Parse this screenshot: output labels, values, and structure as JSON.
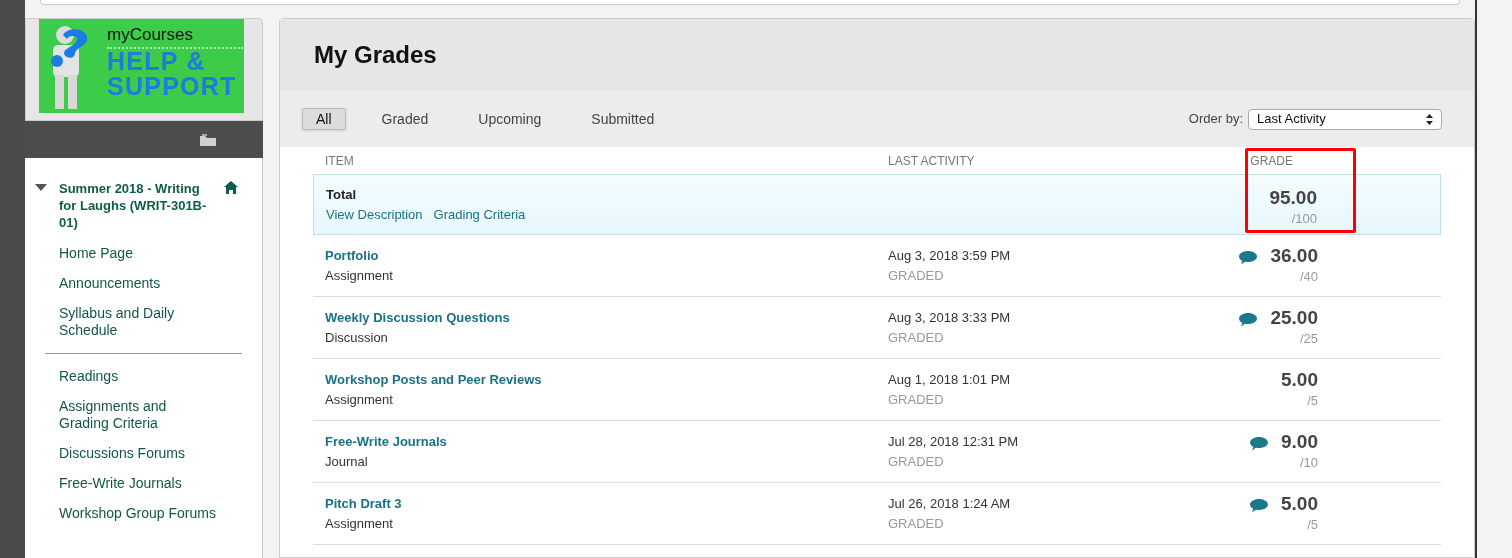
{
  "logo": {
    "title": "myCourses",
    "line_1": "HELP &",
    "line_2": "SUPPORT"
  },
  "course": {
    "title": "Summer 2018 - Writing for Laughs (WRIT-301B-01)",
    "expanded": true
  },
  "menu": {
    "groups": [
      {
        "items": [
          {
            "label": "Home Page"
          },
          {
            "label": "Announcements"
          },
          {
            "label": "Syllabus and Daily Schedule"
          }
        ]
      },
      {
        "items": [
          {
            "label": "Readings"
          },
          {
            "label": "Assignments and Grading Criteria"
          },
          {
            "label": "Discussions Forums"
          },
          {
            "label": "Free-Write Journals"
          },
          {
            "label": "Workshop Group Forums"
          }
        ]
      }
    ]
  },
  "page_title": "My Grades",
  "filters": [
    {
      "label": "All",
      "selected": true
    },
    {
      "label": "Graded",
      "selected": false
    },
    {
      "label": "Upcoming",
      "selected": false
    },
    {
      "label": "Submitted",
      "selected": false
    }
  ],
  "order_by": {
    "label": "Order by:",
    "value": "Last Activity"
  },
  "table": {
    "columns": [
      "ITEM",
      "LAST ACTIVITY",
      "GRADE"
    ],
    "total": {
      "title": "Total",
      "links": [
        "View Description",
        "Grading Criteria"
      ],
      "grade": "95.00",
      "out_of": "/100",
      "highlighted": true
    },
    "rows": [
      {
        "title": "Portfolio",
        "type": "Assignment",
        "date": "Aug 3, 2018 3:59 PM",
        "status": "GRADED",
        "comment": true,
        "grade": "36.00",
        "out_of": "/40"
      },
      {
        "title": "Weekly Discussion Questions",
        "type": "Discussion",
        "date": "Aug 3, 2018 3:33 PM",
        "status": "GRADED",
        "comment": true,
        "grade": "25.00",
        "out_of": "/25"
      },
      {
        "title": "Workshop Posts and Peer Reviews",
        "type": "Assignment",
        "date": "Aug 1, 2018 1:01 PM",
        "status": "GRADED",
        "comment": false,
        "grade": "5.00",
        "out_of": "/5"
      },
      {
        "title": "Free-Write Journals",
        "type": "Journal",
        "date": "Jul 28, 2018 12:31 PM",
        "status": "GRADED",
        "comment": true,
        "grade": "9.00",
        "out_of": "/10"
      },
      {
        "title": "Pitch Draft 3",
        "type": "Assignment",
        "date": "Jul 26, 2018 1:24 AM",
        "status": "GRADED",
        "comment": true,
        "grade": "5.00",
        "out_of": "/5"
      }
    ]
  }
}
